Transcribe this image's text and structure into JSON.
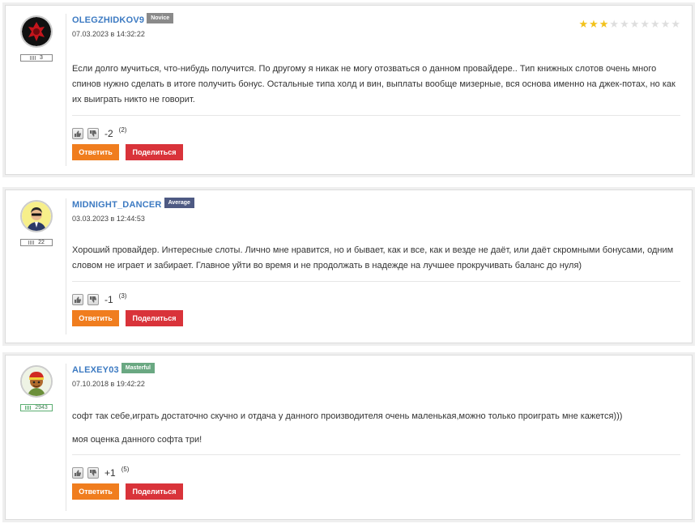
{
  "comments": [
    {
      "username": "OLEGZHIDKOV9",
      "badge": "Novice",
      "date": "07.03.2023 в 14:32:22",
      "post_count": "3",
      "rating": 3,
      "rating_max": 10,
      "paragraphs": [
        "Если долго мучиться, что-нибудь получится. По другому я никак не могу отозваться о данном провайдере.. Тип книжных слотов очень много спинов нужно сделать в итоге получить бонус. Остальные типа холд и вин, выплаты вообще мизерные, вся основа именно на джек-потах, но как их выиграть никто не говорит."
      ],
      "score": "-2",
      "score_count": "(2)",
      "reply_label": "Ответить",
      "share_label": "Поделиться"
    },
    {
      "username": "MIDNIGHT_DANCER",
      "badge": "Average",
      "date": "03.03.2023 в 12:44:53",
      "post_count": "22",
      "paragraphs": [
        "Хороший провайдер. Интересные слоты. Лично мне нравится, но и бывает, как и все, как и везде не даёт, или даёт скромными бонусами, одним словом не играет и забирает. Главное уйти во время и не продолжать в надежде на лучшее прокручивать баланс до нуля)"
      ],
      "score": "-1",
      "score_count": "(3)",
      "reply_label": "Ответить",
      "share_label": "Поделиться"
    },
    {
      "username": "ALEXEY03",
      "badge": "Masterful",
      "date": "07.10.2018 в 19:42:22",
      "post_count": "2943",
      "paragraphs": [
        "софт так себе,играть достаточно скучно и отдача у данного производителя очень маленькая,можно только проиграть мне кажется)))",
        "моя оценка данного софта три!"
      ],
      "score": "+1",
      "score_count": "(5)",
      "reply_label": "Ответить",
      "share_label": "Поделиться"
    }
  ],
  "colors": {
    "username": "#3c7ac2",
    "reply_button": "#f07d1e",
    "share_button": "#d9333a",
    "star_on": "#f2c21b",
    "star_off": "#dedede"
  },
  "icons": {
    "thumbs_up": "thumbs-up-icon",
    "thumbs_down": "thumbs-down-icon"
  }
}
